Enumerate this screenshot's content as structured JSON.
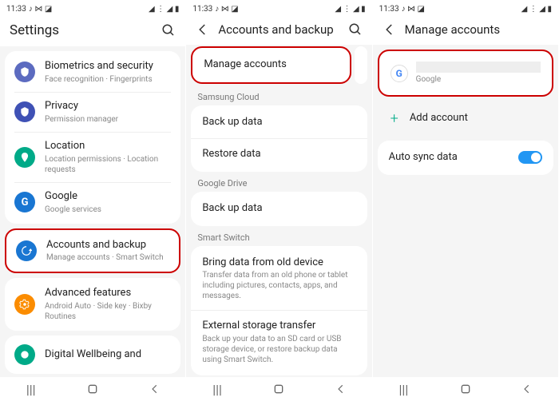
{
  "status": {
    "time": "11:33",
    "icons_l": "♪ ⋈ ◪",
    "icons_r": "◢ ⋮ ◢ ▮"
  },
  "p1": {
    "title": "Settings",
    "items": [
      {
        "t": "Biometrics and security",
        "s": "Face recognition · Fingerprints"
      },
      {
        "t": "Privacy",
        "s": "Permission manager"
      },
      {
        "t": "Location",
        "s": "Location permissions · Location requests"
      },
      {
        "t": "Google",
        "s": "Google services"
      },
      {
        "t": "Accounts and backup",
        "s": "Manage accounts · Smart Switch"
      },
      {
        "t": "Advanced features",
        "s": "Android Auto · Side key · Bixby Routines"
      },
      {
        "t": "Digital Wellbeing and"
      }
    ]
  },
  "p2": {
    "title": "Accounts and backup",
    "manage": "Manage accounts",
    "sec1": "Samsung Cloud",
    "backup": "Back up data",
    "restore": "Restore data",
    "sec2": "Google Drive",
    "backup2": "Back up data",
    "sec3": "Smart Switch",
    "bring_t": "Bring data from old device",
    "bring_s": "Transfer data from an old phone or tablet including pictures, contacts, apps, and messages.",
    "ext_t": "External storage transfer",
    "ext_s": "Back up your data to an SD card or USB storage device, or restore backup data using Smart Switch."
  },
  "p3": {
    "title": "Manage accounts",
    "google": "Google",
    "add": "Add account",
    "sync": "Auto sync data"
  }
}
